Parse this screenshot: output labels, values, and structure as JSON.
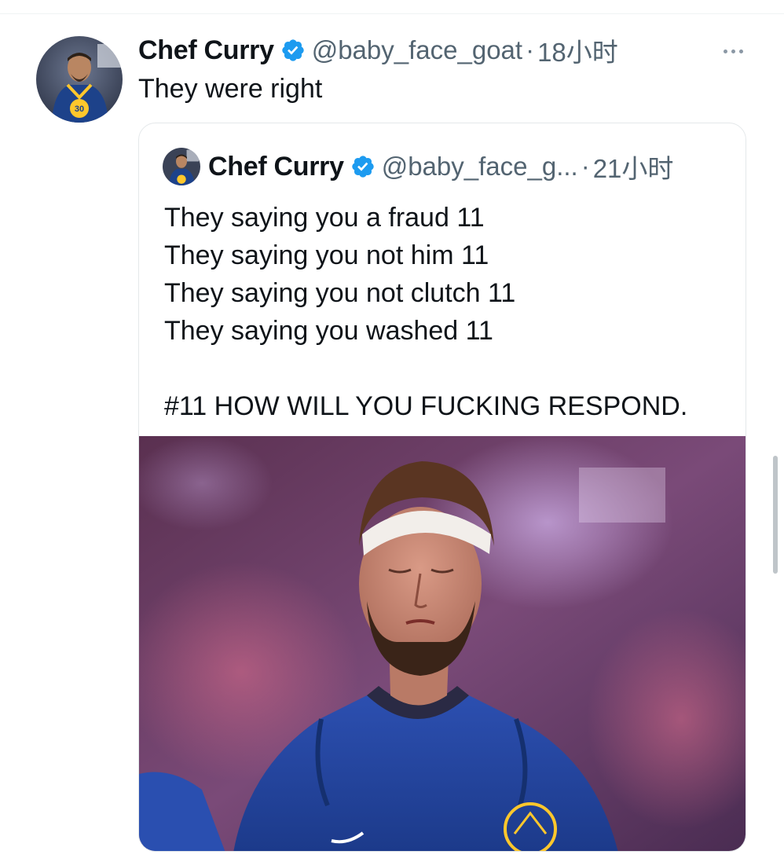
{
  "tweet": {
    "author_name": "Chef Curry",
    "handle": "@baby_face_goat",
    "separator": "·",
    "timestamp": "18小时",
    "text": "They were right",
    "avatar_icon": "player-avatar",
    "verified_icon": "verified-badge-icon",
    "more_icon": "more-options-icon"
  },
  "quote": {
    "author_name": "Chef Curry",
    "handle": "@baby_face_g...",
    "separator": "·",
    "timestamp": "21小时",
    "lines": [
      "They saying you a fraud 11",
      "They saying you not him 11",
      "They saying you not clutch 11",
      "They saying you washed 11"
    ],
    "closing_line": "#11 HOW WILL YOU FUCKING RESPOND.",
    "media_icon": "player-photo"
  },
  "colors": {
    "verified_blue": "#1d9bf0",
    "secondary_text": "#536471",
    "primary_text": "#0f1419",
    "jersey_blue": "#1d428a"
  }
}
